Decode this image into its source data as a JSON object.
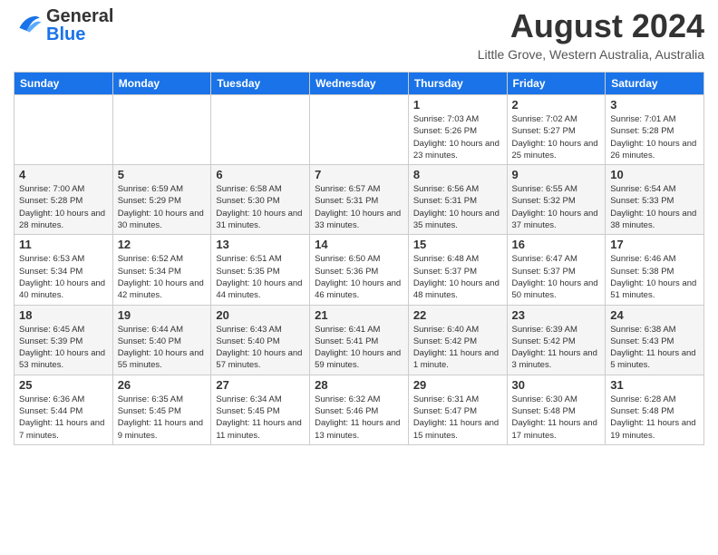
{
  "header": {
    "logo_general": "General",
    "logo_blue": "Blue",
    "month_year": "August 2024",
    "location": "Little Grove, Western Australia, Australia"
  },
  "weekdays": [
    "Sunday",
    "Monday",
    "Tuesday",
    "Wednesday",
    "Thursday",
    "Friday",
    "Saturday"
  ],
  "weeks": [
    [
      {
        "day": "",
        "sunrise": "",
        "sunset": "",
        "daylight": ""
      },
      {
        "day": "",
        "sunrise": "",
        "sunset": "",
        "daylight": ""
      },
      {
        "day": "",
        "sunrise": "",
        "sunset": "",
        "daylight": ""
      },
      {
        "day": "",
        "sunrise": "",
        "sunset": "",
        "daylight": ""
      },
      {
        "day": "1",
        "sunrise": "Sunrise: 7:03 AM",
        "sunset": "Sunset: 5:26 PM",
        "daylight": "Daylight: 10 hours and 23 minutes."
      },
      {
        "day": "2",
        "sunrise": "Sunrise: 7:02 AM",
        "sunset": "Sunset: 5:27 PM",
        "daylight": "Daylight: 10 hours and 25 minutes."
      },
      {
        "day": "3",
        "sunrise": "Sunrise: 7:01 AM",
        "sunset": "Sunset: 5:28 PM",
        "daylight": "Daylight: 10 hours and 26 minutes."
      }
    ],
    [
      {
        "day": "4",
        "sunrise": "Sunrise: 7:00 AM",
        "sunset": "Sunset: 5:28 PM",
        "daylight": "Daylight: 10 hours and 28 minutes."
      },
      {
        "day": "5",
        "sunrise": "Sunrise: 6:59 AM",
        "sunset": "Sunset: 5:29 PM",
        "daylight": "Daylight: 10 hours and 30 minutes."
      },
      {
        "day": "6",
        "sunrise": "Sunrise: 6:58 AM",
        "sunset": "Sunset: 5:30 PM",
        "daylight": "Daylight: 10 hours and 31 minutes."
      },
      {
        "day": "7",
        "sunrise": "Sunrise: 6:57 AM",
        "sunset": "Sunset: 5:31 PM",
        "daylight": "Daylight: 10 hours and 33 minutes."
      },
      {
        "day": "8",
        "sunrise": "Sunrise: 6:56 AM",
        "sunset": "Sunset: 5:31 PM",
        "daylight": "Daylight: 10 hours and 35 minutes."
      },
      {
        "day": "9",
        "sunrise": "Sunrise: 6:55 AM",
        "sunset": "Sunset: 5:32 PM",
        "daylight": "Daylight: 10 hours and 37 minutes."
      },
      {
        "day": "10",
        "sunrise": "Sunrise: 6:54 AM",
        "sunset": "Sunset: 5:33 PM",
        "daylight": "Daylight: 10 hours and 38 minutes."
      }
    ],
    [
      {
        "day": "11",
        "sunrise": "Sunrise: 6:53 AM",
        "sunset": "Sunset: 5:34 PM",
        "daylight": "Daylight: 10 hours and 40 minutes."
      },
      {
        "day": "12",
        "sunrise": "Sunrise: 6:52 AM",
        "sunset": "Sunset: 5:34 PM",
        "daylight": "Daylight: 10 hours and 42 minutes."
      },
      {
        "day": "13",
        "sunrise": "Sunrise: 6:51 AM",
        "sunset": "Sunset: 5:35 PM",
        "daylight": "Daylight: 10 hours and 44 minutes."
      },
      {
        "day": "14",
        "sunrise": "Sunrise: 6:50 AM",
        "sunset": "Sunset: 5:36 PM",
        "daylight": "Daylight: 10 hours and 46 minutes."
      },
      {
        "day": "15",
        "sunrise": "Sunrise: 6:48 AM",
        "sunset": "Sunset: 5:37 PM",
        "daylight": "Daylight: 10 hours and 48 minutes."
      },
      {
        "day": "16",
        "sunrise": "Sunrise: 6:47 AM",
        "sunset": "Sunset: 5:37 PM",
        "daylight": "Daylight: 10 hours and 50 minutes."
      },
      {
        "day": "17",
        "sunrise": "Sunrise: 6:46 AM",
        "sunset": "Sunset: 5:38 PM",
        "daylight": "Daylight: 10 hours and 51 minutes."
      }
    ],
    [
      {
        "day": "18",
        "sunrise": "Sunrise: 6:45 AM",
        "sunset": "Sunset: 5:39 PM",
        "daylight": "Daylight: 10 hours and 53 minutes."
      },
      {
        "day": "19",
        "sunrise": "Sunrise: 6:44 AM",
        "sunset": "Sunset: 5:40 PM",
        "daylight": "Daylight: 10 hours and 55 minutes."
      },
      {
        "day": "20",
        "sunrise": "Sunrise: 6:43 AM",
        "sunset": "Sunset: 5:40 PM",
        "daylight": "Daylight: 10 hours and 57 minutes."
      },
      {
        "day": "21",
        "sunrise": "Sunrise: 6:41 AM",
        "sunset": "Sunset: 5:41 PM",
        "daylight": "Daylight: 10 hours and 59 minutes."
      },
      {
        "day": "22",
        "sunrise": "Sunrise: 6:40 AM",
        "sunset": "Sunset: 5:42 PM",
        "daylight": "Daylight: 11 hours and 1 minute."
      },
      {
        "day": "23",
        "sunrise": "Sunrise: 6:39 AM",
        "sunset": "Sunset: 5:42 PM",
        "daylight": "Daylight: 11 hours and 3 minutes."
      },
      {
        "day": "24",
        "sunrise": "Sunrise: 6:38 AM",
        "sunset": "Sunset: 5:43 PM",
        "daylight": "Daylight: 11 hours and 5 minutes."
      }
    ],
    [
      {
        "day": "25",
        "sunrise": "Sunrise: 6:36 AM",
        "sunset": "Sunset: 5:44 PM",
        "daylight": "Daylight: 11 hours and 7 minutes."
      },
      {
        "day": "26",
        "sunrise": "Sunrise: 6:35 AM",
        "sunset": "Sunset: 5:45 PM",
        "daylight": "Daylight: 11 hours and 9 minutes."
      },
      {
        "day": "27",
        "sunrise": "Sunrise: 6:34 AM",
        "sunset": "Sunset: 5:45 PM",
        "daylight": "Daylight: 11 hours and 11 minutes."
      },
      {
        "day": "28",
        "sunrise": "Sunrise: 6:32 AM",
        "sunset": "Sunset: 5:46 PM",
        "daylight": "Daylight: 11 hours and 13 minutes."
      },
      {
        "day": "29",
        "sunrise": "Sunrise: 6:31 AM",
        "sunset": "Sunset: 5:47 PM",
        "daylight": "Daylight: 11 hours and 15 minutes."
      },
      {
        "day": "30",
        "sunrise": "Sunrise: 6:30 AM",
        "sunset": "Sunset: 5:48 PM",
        "daylight": "Daylight: 11 hours and 17 minutes."
      },
      {
        "day": "31",
        "sunrise": "Sunrise: 6:28 AM",
        "sunset": "Sunset: 5:48 PM",
        "daylight": "Daylight: 11 hours and 19 minutes."
      }
    ]
  ]
}
